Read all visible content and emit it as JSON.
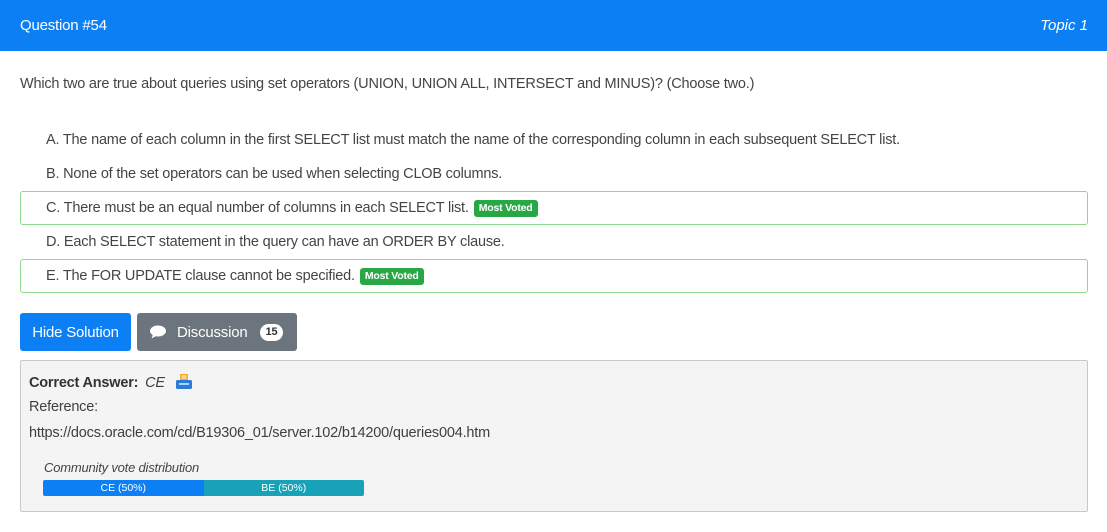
{
  "header": {
    "question_number": "Question #54",
    "topic": "Topic 1"
  },
  "question": {
    "text": "Which two are true about queries using set operators (UNION, UNION ALL, INTERSECT and MINUS)? (Choose two.)"
  },
  "choices": [
    {
      "text": "A. The name of each column in the first SELECT list must match the name of the corresponding column in each subsequent SELECT list.",
      "most_voted": false
    },
    {
      "text": "B. None of the set operators can be used when selecting CLOB columns.",
      "most_voted": false
    },
    {
      "text": "C. There must be an equal number of columns in each SELECT list.",
      "most_voted": true,
      "badge": "Most Voted"
    },
    {
      "text": "D. Each SELECT statement in the query can have an ORDER BY clause.",
      "most_voted": false
    },
    {
      "text": "E. The FOR UPDATE clause cannot be specified.",
      "most_voted": true,
      "badge": "Most Voted"
    }
  ],
  "buttons": {
    "hide_solution": "Hide Solution",
    "discussion": "Discussion",
    "discussion_count": "15"
  },
  "answer": {
    "label": "Correct Answer:",
    "value": "CE",
    "reference_label": "Reference:",
    "reference_url": "https://docs.oracle.com/cd/B19306_01/server.102/b14200/queries004.htm"
  },
  "votes": {
    "title": "Community vote distribution",
    "segments": [
      {
        "label": "CE (50%)",
        "fraction": 0.5,
        "color": "#0d7ff5"
      },
      {
        "label": "BE (50%)",
        "fraction": 0.5,
        "color": "#17a2b8"
      }
    ]
  },
  "colors": {
    "primary": "#0d7ff5",
    "success": "#28a745",
    "secondary": "#6c757d"
  }
}
